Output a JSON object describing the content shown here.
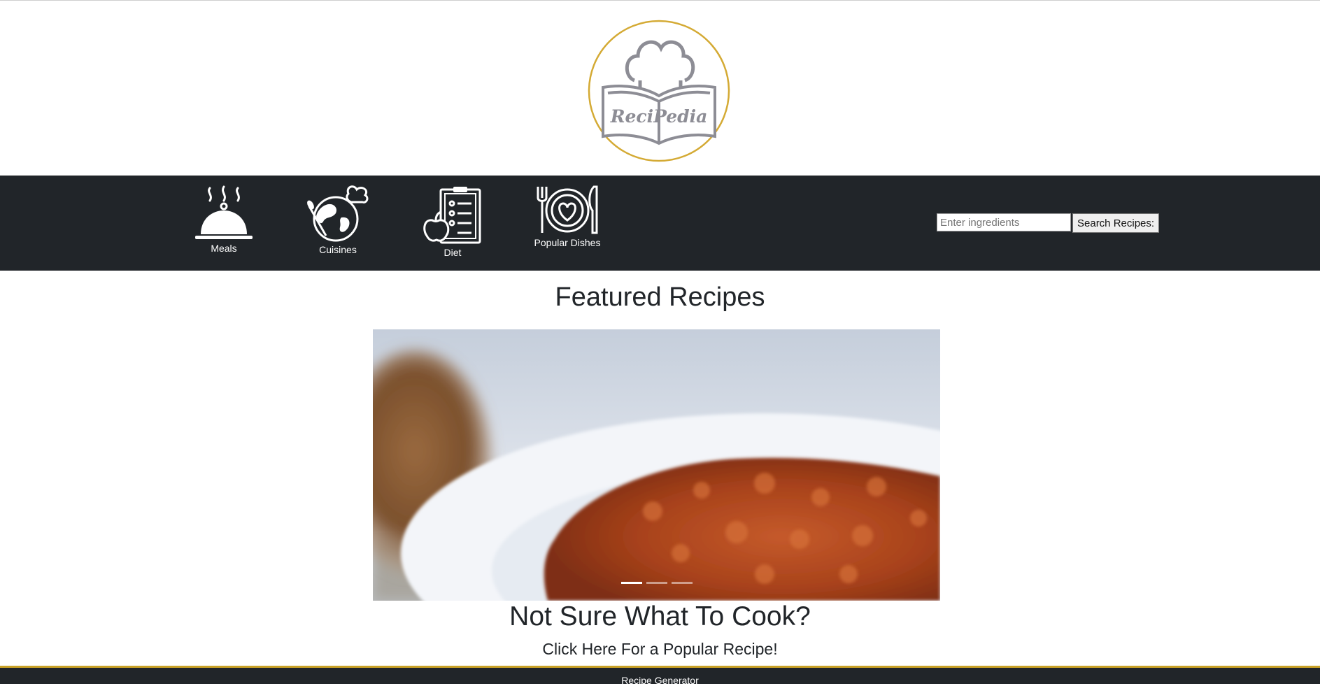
{
  "brand": {
    "logo_text": "ReciPedia",
    "ring_color": "#d4aa34",
    "gray_color": "#8d8d95"
  },
  "nav": {
    "items": [
      {
        "label": "Meals",
        "icon": "cloche-icon"
      },
      {
        "label": "Cuisines",
        "icon": "globe-chef-icon"
      },
      {
        "label": "Diet",
        "icon": "clipboard-apple-icon"
      },
      {
        "label": "Popular Dishes",
        "icon": "plate-heart-icon"
      }
    ]
  },
  "search": {
    "placeholder": "Enter ingredients",
    "value": "",
    "button_label": "Search Recipes:"
  },
  "featured": {
    "title": "Featured Recipes",
    "carousel": {
      "slide_count": 3,
      "active_index": 0,
      "image": "blurred-bolognese-plate"
    }
  },
  "cta": {
    "title": "Not Sure What To Cook?",
    "link_text": "Click Here For a Popular Recipe!"
  },
  "footer": {
    "text": "Recipe Generator",
    "accent": "#c9a227"
  },
  "colors": {
    "navbar_bg": "#212529",
    "text": "#212529"
  }
}
